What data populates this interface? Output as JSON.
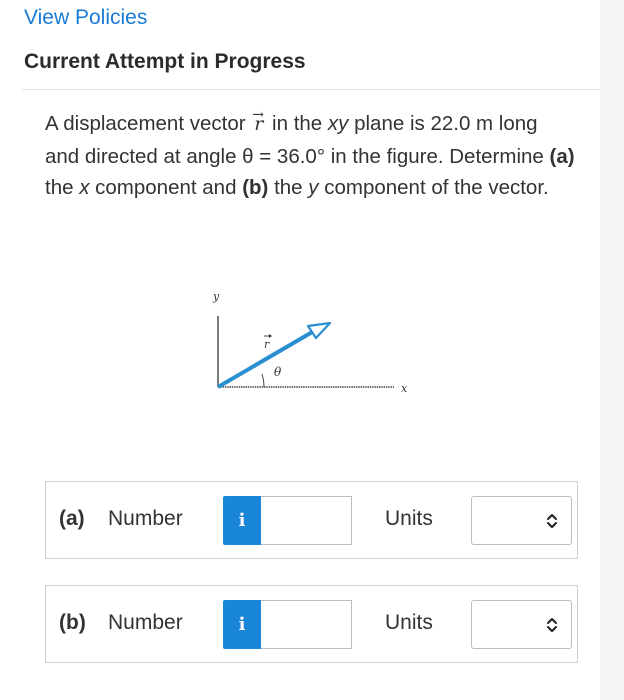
{
  "header": {
    "view_policies": "View Policies",
    "attempt_title": "Current Attempt in Progress"
  },
  "question": {
    "part1": "A displacement vector ",
    "vector_symbol": "r",
    "vector_arrow": "→",
    "part2": " in the ",
    "plane": "xy",
    "part3": " plane is 22.0 m long and directed at angle θ = 36.0° in the figure. Determine ",
    "a_label": "(a)",
    "part4": " the ",
    "x_var": "x",
    "part5": " component and ",
    "b_label": "(b)",
    "part6": " the ",
    "y_var": "y",
    "part7": " component of the vector."
  },
  "figure": {
    "y_axis_label": "y",
    "x_axis_label": "x",
    "vector_label": "r",
    "angle_label": "θ",
    "vector_color": "#2a8fd0"
  },
  "answers": [
    {
      "part": "(a)",
      "number_label": "Number",
      "info_icon": "i",
      "value": "",
      "units_label": "Units",
      "units_value": ""
    },
    {
      "part": "(b)",
      "number_label": "Number",
      "info_icon": "i",
      "value": "",
      "units_label": "Units",
      "units_value": ""
    }
  ],
  "colors": {
    "link": "#1a7bd6",
    "info_button": "#1a86d8"
  }
}
